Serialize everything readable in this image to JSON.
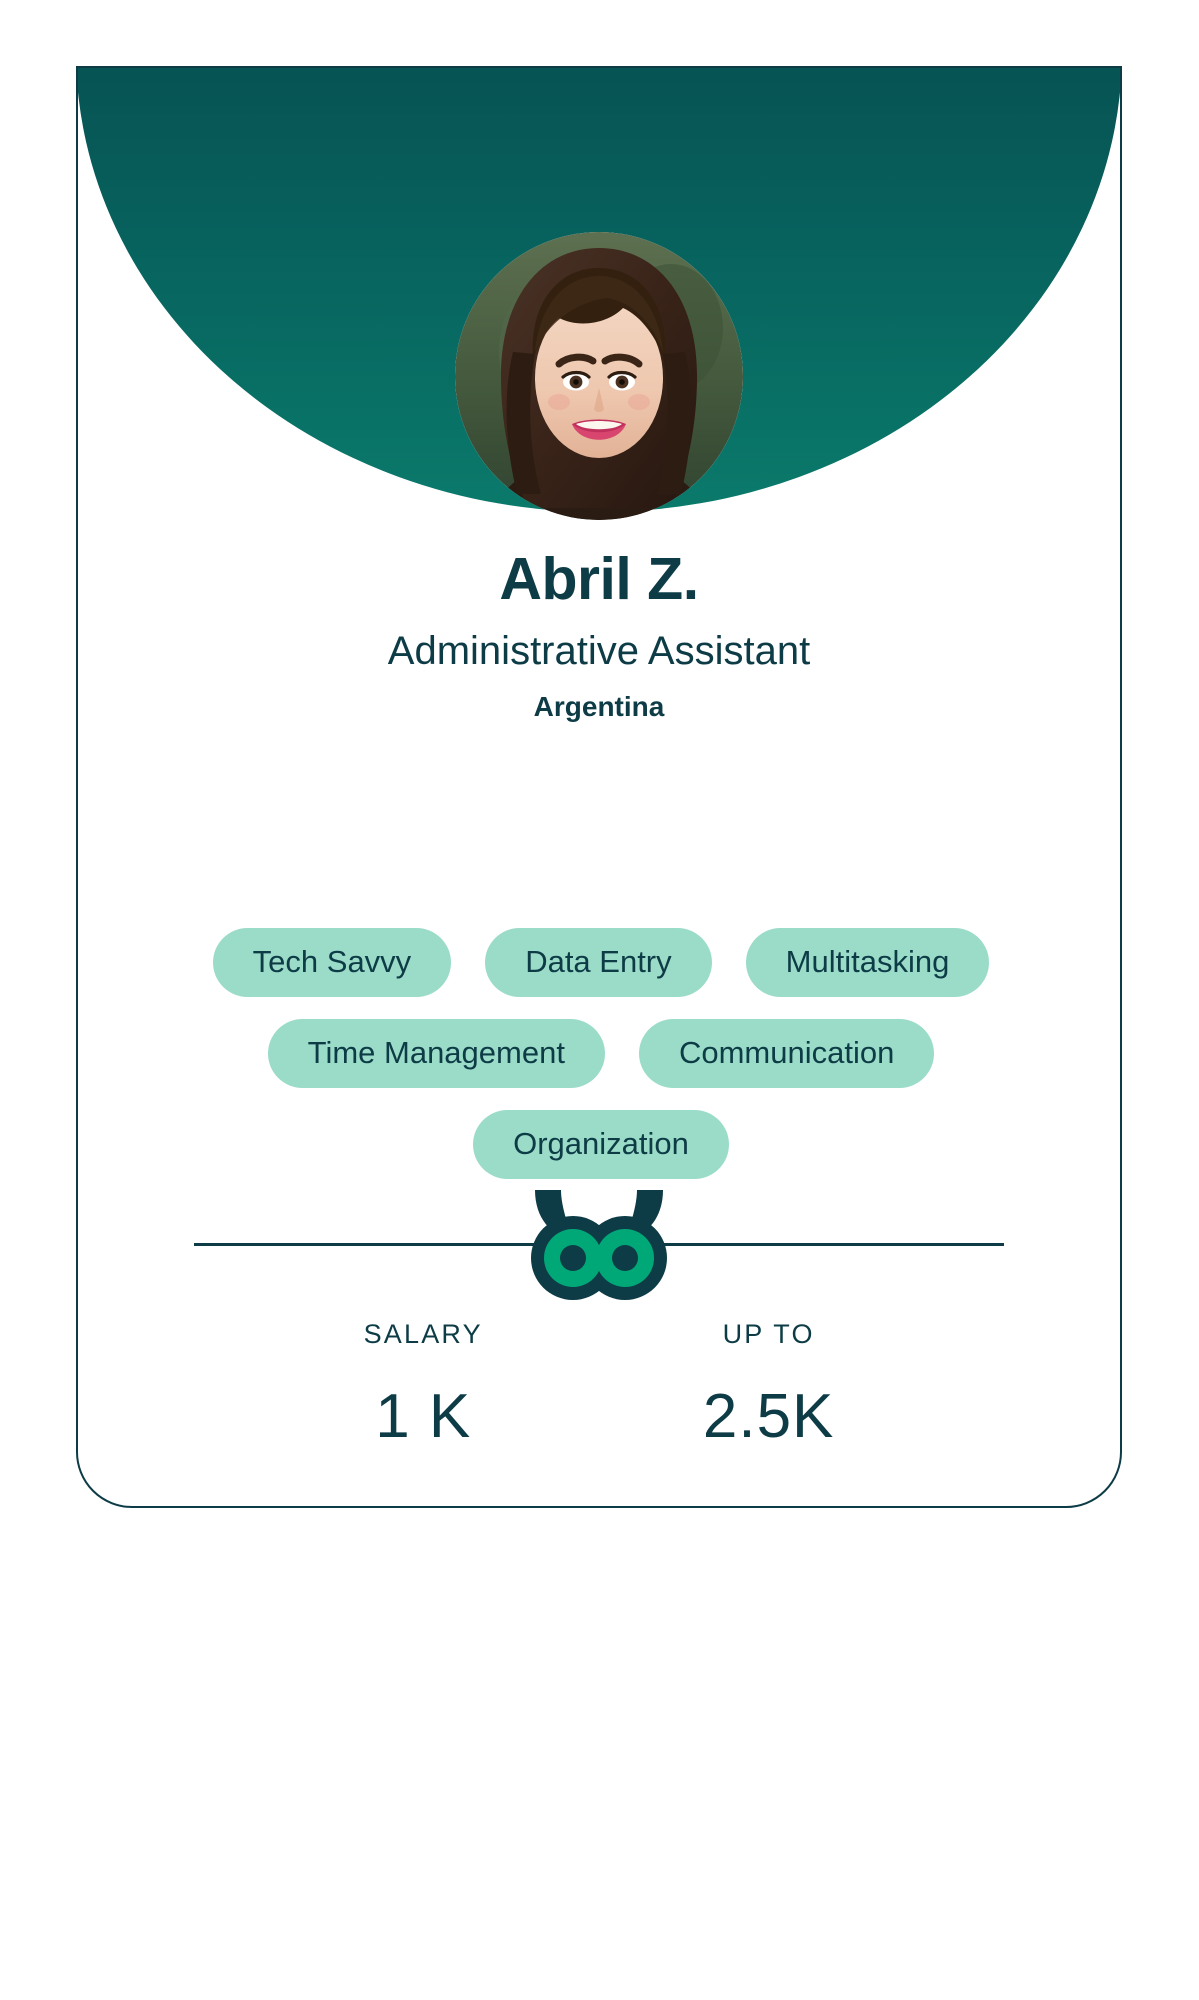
{
  "card": {
    "accent_dark": "#0d3c46",
    "accent_green": "#00a878",
    "pill_bg": "#9bdcc9",
    "banner_gradient_from": "#063c43",
    "banner_gradient_to": "#0a7a6b"
  },
  "profile": {
    "avatar_alt": "avatar-photo",
    "name": "Abril Z.",
    "role": "Administrative Assistant",
    "country": "Argentina"
  },
  "skills": [
    {
      "label": "Tech Savvy"
    },
    {
      "label": "Data Entry"
    },
    {
      "label": "Multitasking"
    },
    {
      "label": "Time Management"
    },
    {
      "label": "Communication"
    },
    {
      "label": "Organization"
    }
  ],
  "logo": {
    "name": "owl-logo"
  },
  "salary": {
    "from_label": "SALARY",
    "from_value": "1 K",
    "to_label": "UP TO",
    "to_value": "2.5K"
  }
}
